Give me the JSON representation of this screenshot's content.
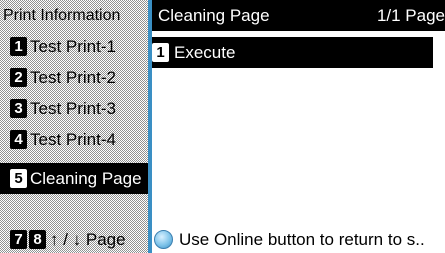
{
  "left_panel": {
    "title": "Print Information",
    "items": [
      {
        "num": "1",
        "label": "Test Print-1",
        "selected": false
      },
      {
        "num": "2",
        "label": "Test Print-2",
        "selected": false
      },
      {
        "num": "3",
        "label": "Test Print-3",
        "selected": false
      },
      {
        "num": "4",
        "label": "Test Print-4",
        "selected": false
      },
      {
        "num": "5",
        "label": "Cleaning Page",
        "selected": true
      }
    ],
    "footer": {
      "key_a": "7",
      "key_b": "8",
      "hint": "↑ / ↓ Page"
    }
  },
  "right_panel": {
    "title": "Cleaning Page",
    "page_indicator": "1/1 Page",
    "execute": {
      "num": "1",
      "label": "Execute"
    },
    "status": {
      "icon": "online-button-icon",
      "text": "Use Online button to return to s.."
    }
  },
  "colors": {
    "accent": "#3a8fc4",
    "header_bg": "#000000",
    "selected_bg": "#000000"
  }
}
